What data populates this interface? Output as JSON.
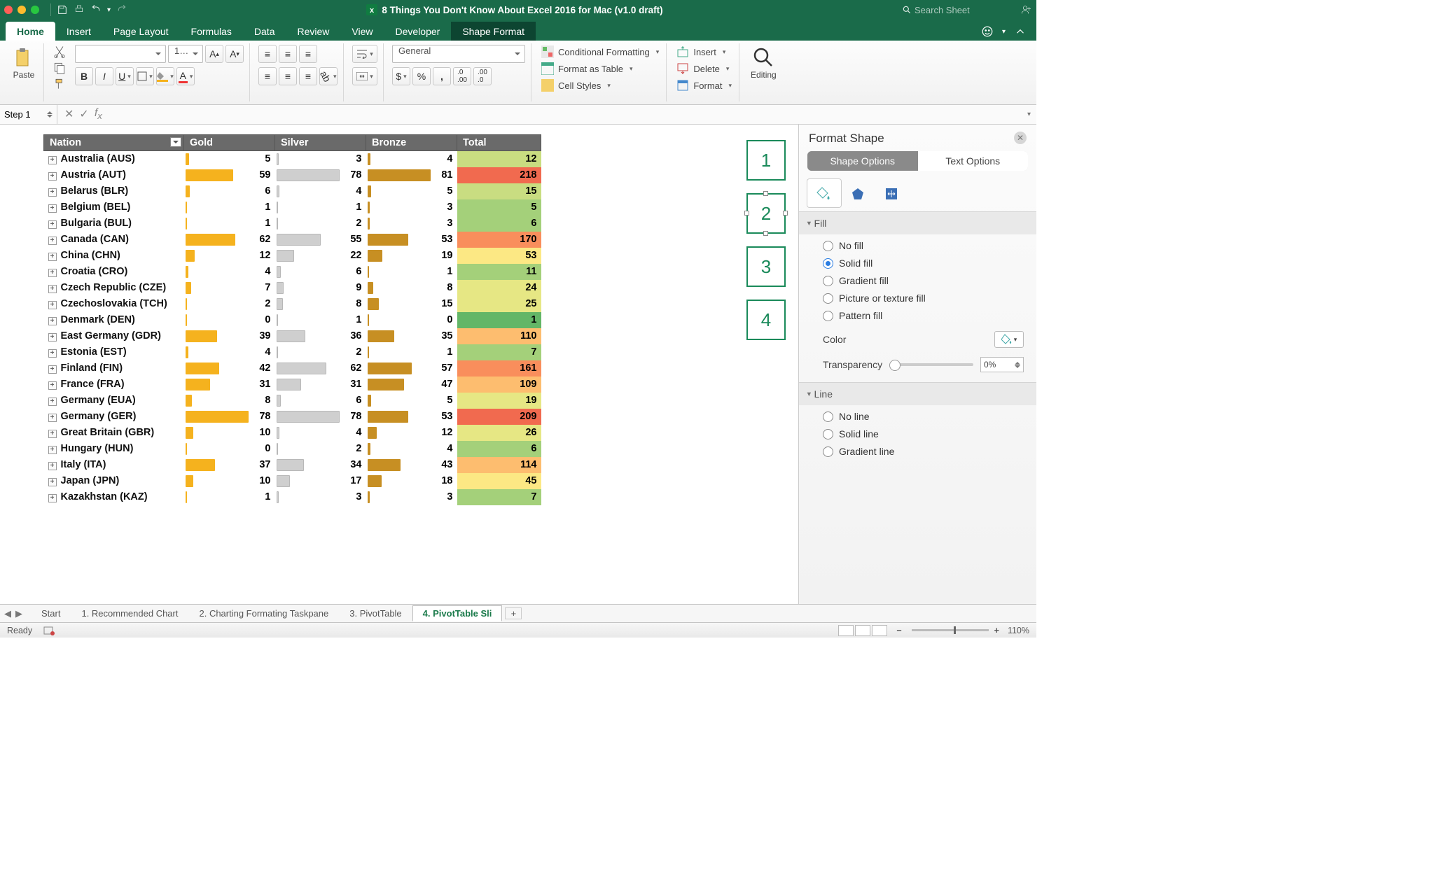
{
  "title": "8 Things You Don't Know About Excel 2016 for Mac (v1.0 draft)",
  "search_placeholder": "Search Sheet",
  "tabs": [
    "Home",
    "Insert",
    "Page Layout",
    "Formulas",
    "Data",
    "Review",
    "View",
    "Developer",
    "Shape Format"
  ],
  "active_tab": "Home",
  "dark_tab": "Shape Format",
  "ribbon": {
    "paste": "Paste",
    "font_size": "1…",
    "number_format": "General",
    "cond_fmt": "Conditional Formatting",
    "fmt_table": "Format as Table",
    "cell_styles": "Cell Styles",
    "insert": "Insert",
    "delete": "Delete",
    "format": "Format",
    "editing": "Editing"
  },
  "namebox": "Step 1",
  "columns": [
    "Nation",
    "Gold",
    "Silver",
    "Bronze",
    "Total"
  ],
  "max": {
    "gold": 78,
    "silver": 78,
    "bronze": 81
  },
  "rows": [
    {
      "nation": "Australia (AUS)",
      "gold": 5,
      "silver": 3,
      "bronze": 4,
      "total": 12,
      "heat": "h3"
    },
    {
      "nation": "Austria (AUT)",
      "gold": 59,
      "silver": 78,
      "bronze": 81,
      "total": 218,
      "heat": "h8"
    },
    {
      "nation": "Belarus (BLR)",
      "gold": 6,
      "silver": 4,
      "bronze": 5,
      "total": 15,
      "heat": "h3"
    },
    {
      "nation": "Belgium (BEL)",
      "gold": 1,
      "silver": 1,
      "bronze": 3,
      "total": 5,
      "heat": "h2"
    },
    {
      "nation": "Bulgaria (BUL)",
      "gold": 1,
      "silver": 2,
      "bronze": 3,
      "total": 6,
      "heat": "h2"
    },
    {
      "nation": "Canada (CAN)",
      "gold": 62,
      "silver": 55,
      "bronze": 53,
      "total": 170,
      "heat": "h7"
    },
    {
      "nation": "China (CHN)",
      "gold": 12,
      "silver": 22,
      "bronze": 19,
      "total": 53,
      "heat": "h5"
    },
    {
      "nation": "Croatia (CRO)",
      "gold": 4,
      "silver": 6,
      "bronze": 1,
      "total": 11,
      "heat": "h2"
    },
    {
      "nation": "Czech Republic (CZE)",
      "gold": 7,
      "silver": 9,
      "bronze": 8,
      "total": 24,
      "heat": "h4"
    },
    {
      "nation": "Czechoslovakia (TCH)",
      "gold": 2,
      "silver": 8,
      "bronze": 15,
      "total": 25,
      "heat": "h4"
    },
    {
      "nation": "Denmark (DEN)",
      "gold": 0,
      "silver": 1,
      "bronze": 0,
      "total": 1,
      "heat": "h1"
    },
    {
      "nation": "East Germany (GDR)",
      "gold": 39,
      "silver": 36,
      "bronze": 35,
      "total": 110,
      "heat": "h6"
    },
    {
      "nation": "Estonia (EST)",
      "gold": 4,
      "silver": 2,
      "bronze": 1,
      "total": 7,
      "heat": "h2"
    },
    {
      "nation": "Finland (FIN)",
      "gold": 42,
      "silver": 62,
      "bronze": 57,
      "total": 161,
      "heat": "h7"
    },
    {
      "nation": "France (FRA)",
      "gold": 31,
      "silver": 31,
      "bronze": 47,
      "total": 109,
      "heat": "h6"
    },
    {
      "nation": "Germany (EUA)",
      "gold": 8,
      "silver": 6,
      "bronze": 5,
      "total": 19,
      "heat": "h4"
    },
    {
      "nation": "Germany (GER)",
      "gold": 78,
      "silver": 78,
      "bronze": 53,
      "total": 209,
      "heat": "h8"
    },
    {
      "nation": "Great Britain (GBR)",
      "gold": 10,
      "silver": 4,
      "bronze": 12,
      "total": 26,
      "heat": "h4"
    },
    {
      "nation": "Hungary (HUN)",
      "gold": 0,
      "silver": 2,
      "bronze": 4,
      "total": 6,
      "heat": "h2"
    },
    {
      "nation": "Italy (ITA)",
      "gold": 37,
      "silver": 34,
      "bronze": 43,
      "total": 114,
      "heat": "h6"
    },
    {
      "nation": "Japan (JPN)",
      "gold": 10,
      "silver": 17,
      "bronze": 18,
      "total": 45,
      "heat": "h5"
    },
    {
      "nation": "Kazakhstan (KAZ)",
      "gold": 1,
      "silver": 3,
      "bronze": 3,
      "total": 7,
      "heat": "h2"
    }
  ],
  "slicers": [
    "1",
    "2",
    "3",
    "4"
  ],
  "pane": {
    "title": "Format Shape",
    "tabs": [
      "Shape Options",
      "Text Options"
    ],
    "fill_section": "Fill",
    "fill_opts": [
      "No fill",
      "Solid fill",
      "Gradient fill",
      "Picture or texture fill",
      "Pattern fill"
    ],
    "fill_selected": "Solid fill",
    "color_label": "Color",
    "transp_label": "Transparency",
    "transp_value": "0%",
    "line_section": "Line",
    "line_opts": [
      "No line",
      "Solid line",
      "Gradient line"
    ]
  },
  "sheet_tabs": [
    "Start",
    "1. Recommended Chart",
    "2. Charting Formating Taskpane",
    "3. PivotTable",
    "4. PivotTable Sli"
  ],
  "active_sheet": 4,
  "status": {
    "ready": "Ready",
    "zoom": "110%"
  }
}
